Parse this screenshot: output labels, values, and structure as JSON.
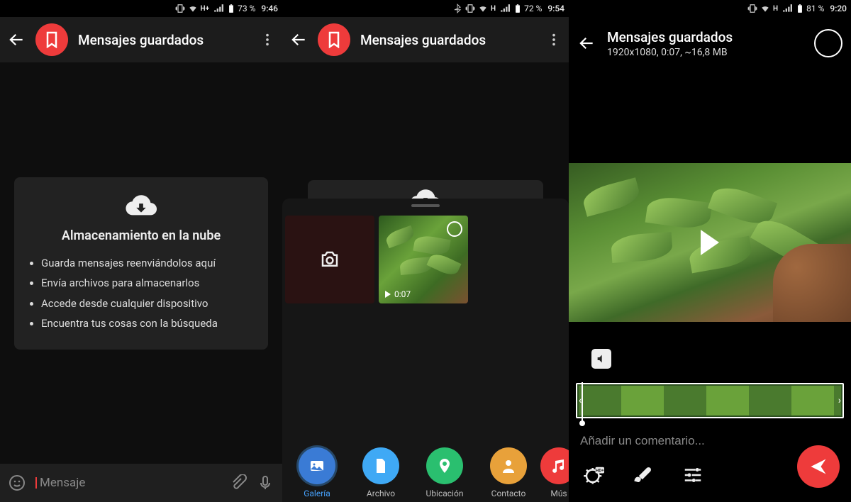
{
  "screen1": {
    "status": {
      "net": "H+",
      "battery": "73 %",
      "time": "9:46"
    },
    "header": {
      "title": "Mensajes guardados"
    },
    "cloud": {
      "title": "Almacenamiento en la nube",
      "items": [
        "Guarda mensajes reenviándolos aquí",
        "Envía archivos para almacenarlos",
        "Accede desde cualquier dispositivo",
        "Encuentra tus cosas con la búsqueda"
      ]
    },
    "input": {
      "placeholder": "Mensaje"
    }
  },
  "screen2": {
    "status": {
      "net": "H",
      "battery": "72 %",
      "time": "9:54"
    },
    "header": {
      "title": "Mensajes guardados"
    },
    "gallery": {
      "video_duration": "0:07"
    },
    "tabs": {
      "gallery": "Galería",
      "file": "Archivo",
      "location": "Ubicación",
      "contact": "Contacto",
      "music": "Mús"
    }
  },
  "screen3": {
    "status": {
      "net": "H",
      "battery": "81 %",
      "time": "9:20"
    },
    "header": {
      "title": "Mensajes guardados",
      "subtitle": "1920x1080, 0:07, ~16,8 MB"
    },
    "comment_placeholder": "Añadir un comentario..."
  }
}
